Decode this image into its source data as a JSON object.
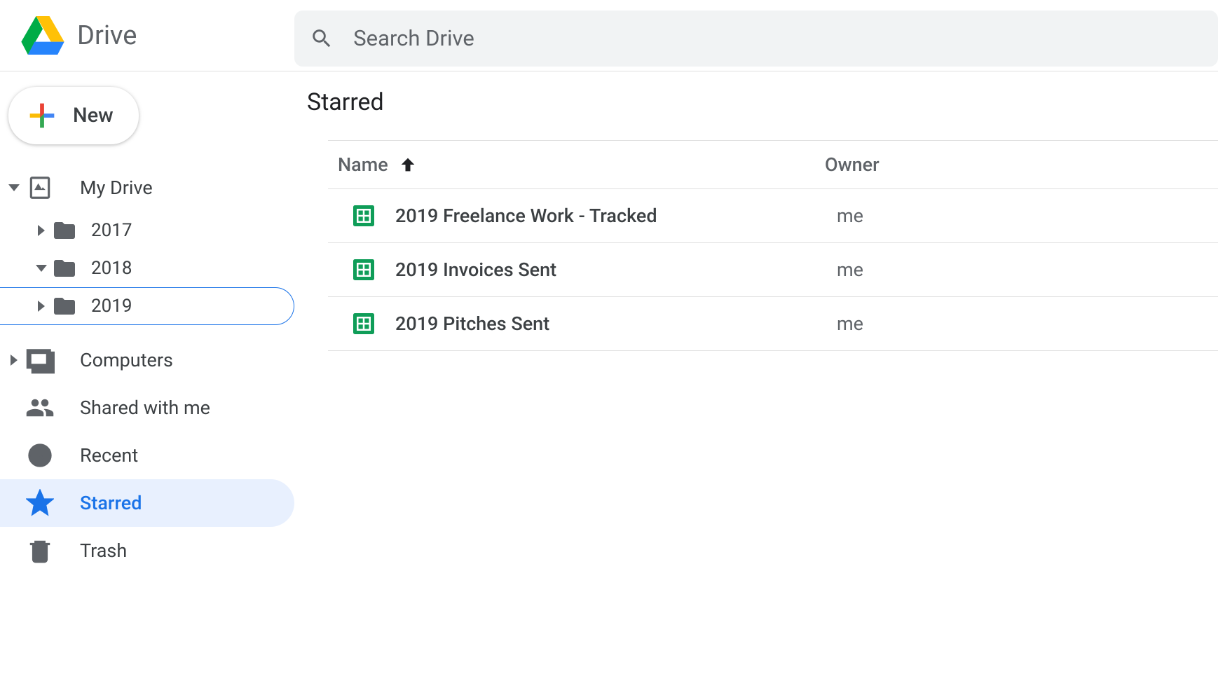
{
  "header": {
    "app_name": "Drive",
    "search_placeholder": "Search Drive"
  },
  "sidebar": {
    "new_label": "New",
    "nav": {
      "my_drive": "My Drive",
      "computers": "Computers",
      "shared": "Shared with me",
      "recent": "Recent",
      "starred": "Starred",
      "trash": "Trash"
    },
    "folders": [
      {
        "name": "2017",
        "expanded": false,
        "selected": false
      },
      {
        "name": "2018",
        "expanded": true,
        "selected": false
      },
      {
        "name": "2019",
        "expanded": false,
        "selected": true
      }
    ]
  },
  "content": {
    "title": "Starred",
    "columns": {
      "name": "Name",
      "owner": "Owner"
    },
    "files": [
      {
        "name": "2019 Freelance Work - Tracked",
        "owner": "me",
        "type": "sheets"
      },
      {
        "name": "2019 Invoices Sent",
        "owner": "me",
        "type": "sheets"
      },
      {
        "name": "2019 Pitches Sent",
        "owner": "me",
        "type": "sheets"
      }
    ]
  }
}
